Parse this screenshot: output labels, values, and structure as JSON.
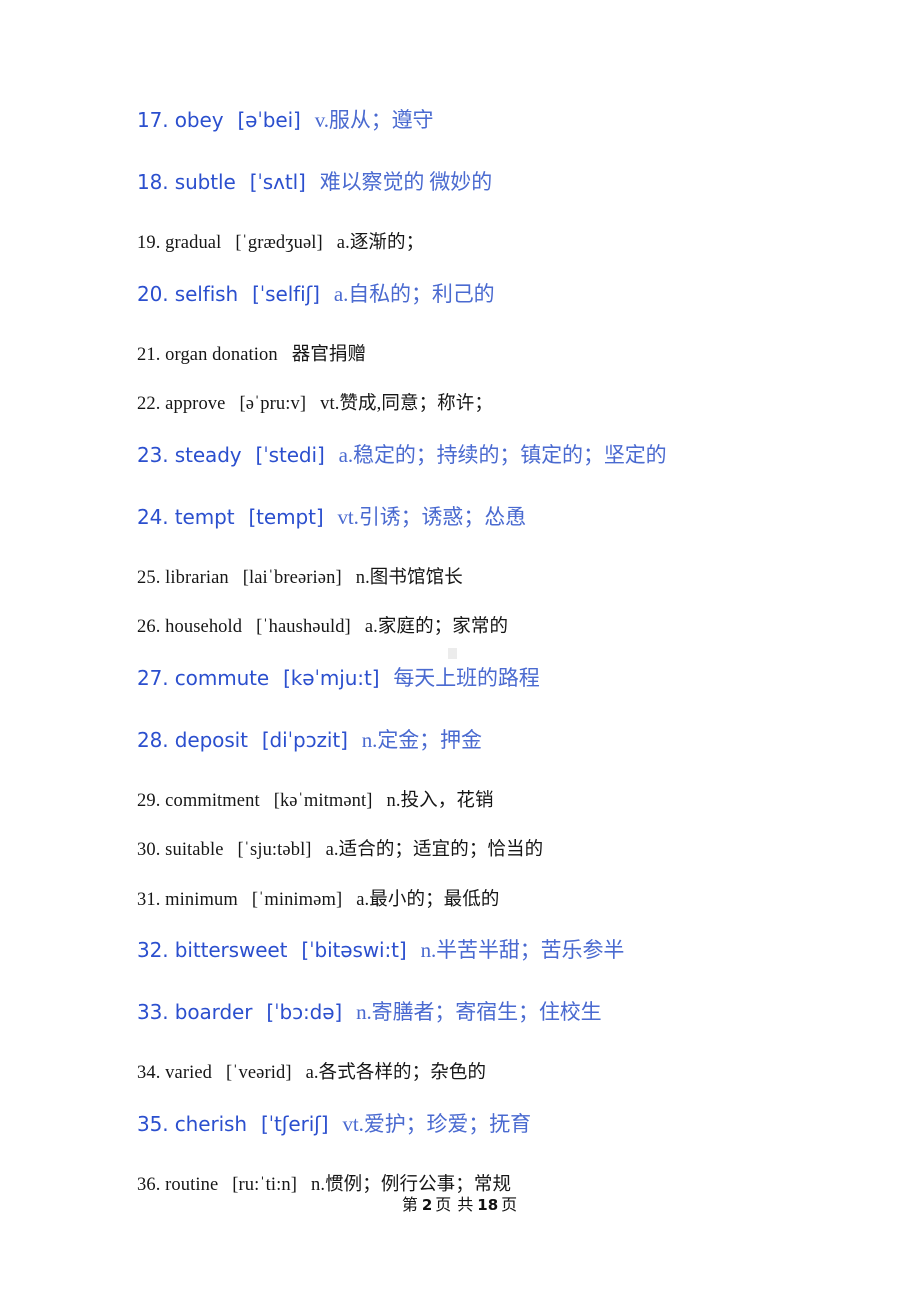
{
  "document": {
    "type": "vocabulary-list",
    "text_color_plain": "#161616",
    "text_color_highlight": "#2b4fce",
    "text_color_highlight_cn": "#4a6ad0",
    "background": "#ffffff"
  },
  "entries": [
    {
      "number": "17.",
      "word": "obey",
      "ipa": "[əˈbei]",
      "pos": "v.",
      "gloss": "服从；遵守",
      "highlighted": true
    },
    {
      "number": "18.",
      "word": "subtle",
      "ipa": "[ˈsʌtl]",
      "pos": "",
      "gloss": "难以察觉的   微妙的",
      "highlighted": true
    },
    {
      "number": "19.",
      "word": "gradual",
      "ipa": "[ˈgrædʒuəl]",
      "pos": "a.",
      "gloss": "逐渐的；",
      "highlighted": false
    },
    {
      "number": "20.",
      "word": "selfish",
      "ipa": "[ˈselfiʃ]",
      "pos": "a.",
      "gloss": "自私的；利己的",
      "highlighted": true
    },
    {
      "number": "21.",
      "word": "organ donation",
      "ipa": "",
      "pos": "",
      "gloss": "器官捐赠",
      "highlighted": false
    },
    {
      "number": "22.",
      "word": "approve",
      "ipa": "[əˈpru:v]",
      "pos": "vt.",
      "gloss": "赞成,同意；称许；",
      "highlighted": false
    },
    {
      "number": "23.",
      "word": "steady",
      "ipa": "[ˈstedi]",
      "pos": "a.",
      "gloss": "稳定的；持续的；镇定的；坚定的",
      "highlighted": true
    },
    {
      "number": "24.",
      "word": "tempt",
      "ipa": "[tempt]",
      "pos": "vt.",
      "gloss": "引诱；诱惑；怂恿",
      "highlighted": true
    },
    {
      "number": "25.",
      "word": "librarian",
      "ipa": "[laiˈbreəriən]",
      "pos": "n.",
      "gloss": "图书馆馆长",
      "highlighted": false
    },
    {
      "number": "26.",
      "word": "household",
      "ipa": "[ˈhaushəuld]",
      "pos": "a.",
      "gloss": "家庭的；家常的",
      "highlighted": false
    },
    {
      "number": "27.",
      "word": "commute",
      "ipa": "[kəˈmju:t]",
      "pos": "",
      "gloss": "每天上班的路程",
      "highlighted": true
    },
    {
      "number": "28.",
      "word": "deposit",
      "ipa": "[diˈpɔzit]",
      "pos": "n.",
      "gloss": "定金；押金",
      "highlighted": true
    },
    {
      "number": "29.",
      "word": "commitment",
      "ipa": "[kəˈmitmənt]",
      "pos": "n.",
      "gloss": "投入，花销",
      "highlighted": false
    },
    {
      "number": "30.",
      "word": "suitable",
      "ipa": "[ˈsju:təbl]",
      "pos": "a.",
      "gloss": "适合的；适宜的；恰当的",
      "highlighted": false
    },
    {
      "number": "31.",
      "word": "minimum",
      "ipa": "[ˈminiməm]",
      "pos": "a.",
      "gloss": "最小的；最低的",
      "highlighted": false
    },
    {
      "number": "32.",
      "word": "bittersweet",
      "ipa": "[ˈbitəswi:t]",
      "pos": "n.",
      "gloss": "半苦半甜；苦乐参半",
      "highlighted": true
    },
    {
      "number": "33.",
      "word": "boarder",
      "ipa": "[ˈbɔ:də]",
      "pos": "n.",
      "gloss": "寄膳者；寄宿生；住校生",
      "highlighted": true
    },
    {
      "number": "34.",
      "word": "varied",
      "ipa": "[ˈveərid]",
      "pos": "a.",
      "gloss": "各式各样的；杂色的",
      "highlighted": false
    },
    {
      "number": "35.",
      "word": "cherish",
      "ipa": "[ˈtʃeriʃ]",
      "pos": "vt.",
      "gloss": "爱护；珍爱；抚育",
      "highlighted": true
    },
    {
      "number": "36.",
      "word": "routine",
      "ipa": "[ru:ˈti:n]",
      "pos": "n.",
      "gloss": "惯例；例行公事；常规",
      "highlighted": false
    }
  ],
  "footer": {
    "prefix": "第",
    "current_page": "2",
    "middle": "页 共",
    "total_pages": "18",
    "suffix": "页"
  }
}
